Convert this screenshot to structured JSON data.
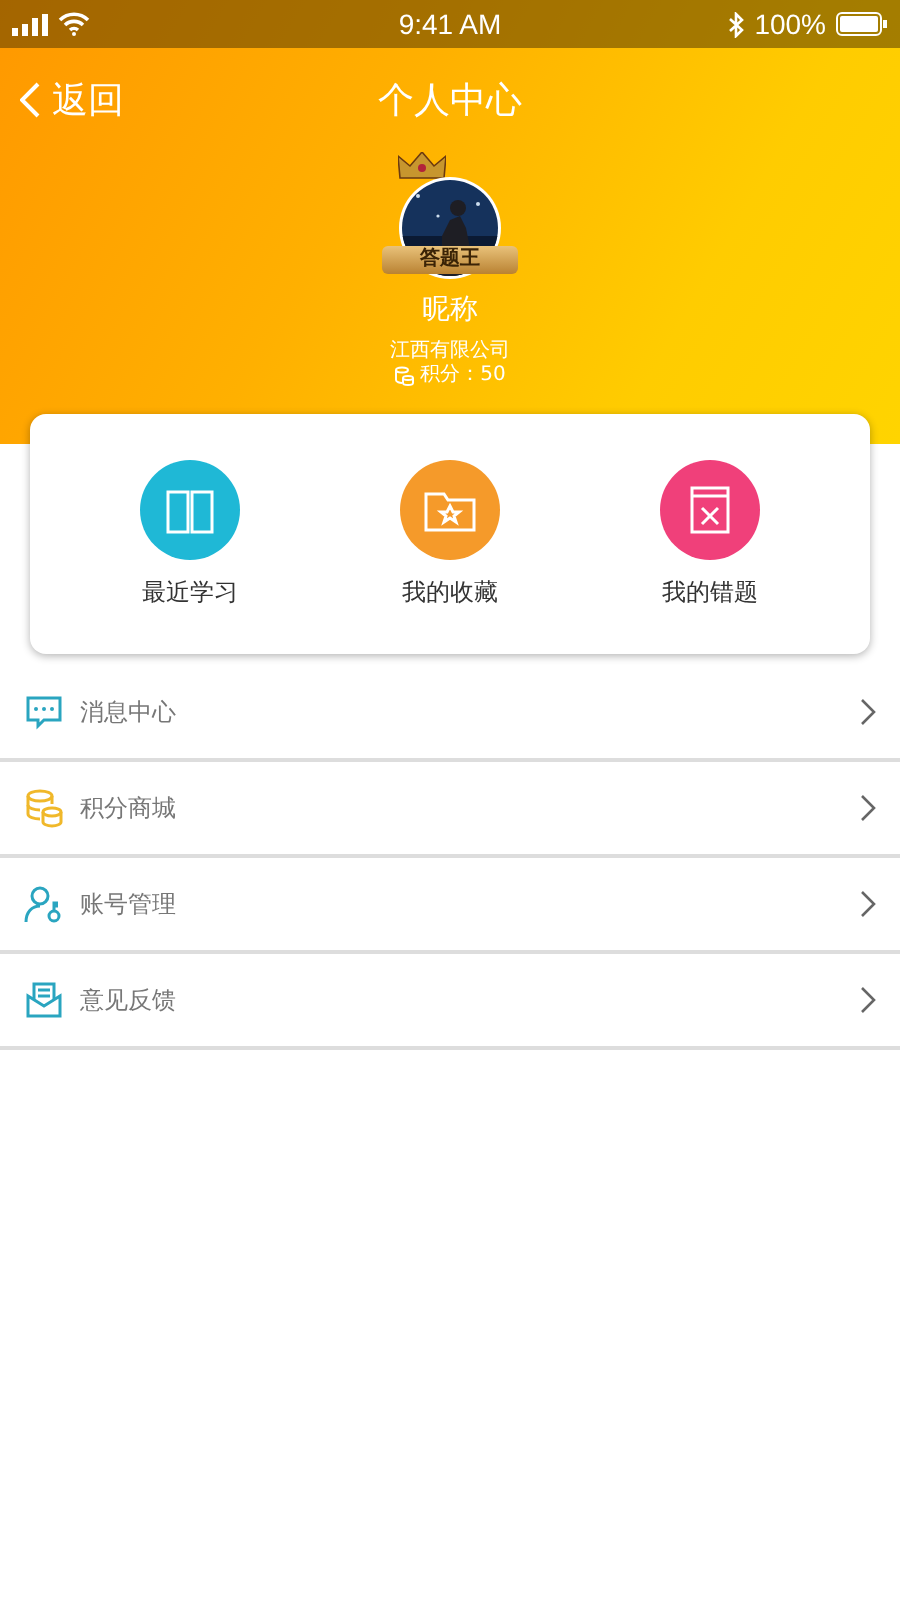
{
  "status_bar": {
    "time": "9:41 AM",
    "battery": "100%"
  },
  "nav": {
    "back": "返回",
    "title": "个人中心"
  },
  "profile": {
    "badge": "答题王",
    "nickname": "昵称",
    "company": "江西有限公司",
    "points": "积分：50"
  },
  "shortcuts": [
    {
      "kind": "book",
      "label": "最近学习",
      "color": "#1fb8d6"
    },
    {
      "kind": "folder",
      "label": "我的收藏",
      "color": "#f59a2a"
    },
    {
      "kind": "wrong",
      "label": "我的错题",
      "color": "#f0407a"
    }
  ],
  "menu": [
    {
      "kind": "message",
      "label": "消息中心"
    },
    {
      "kind": "coins",
      "label": "积分商城"
    },
    {
      "kind": "account",
      "label": "账号管理"
    },
    {
      "kind": "feedback",
      "label": "意见反馈"
    }
  ]
}
